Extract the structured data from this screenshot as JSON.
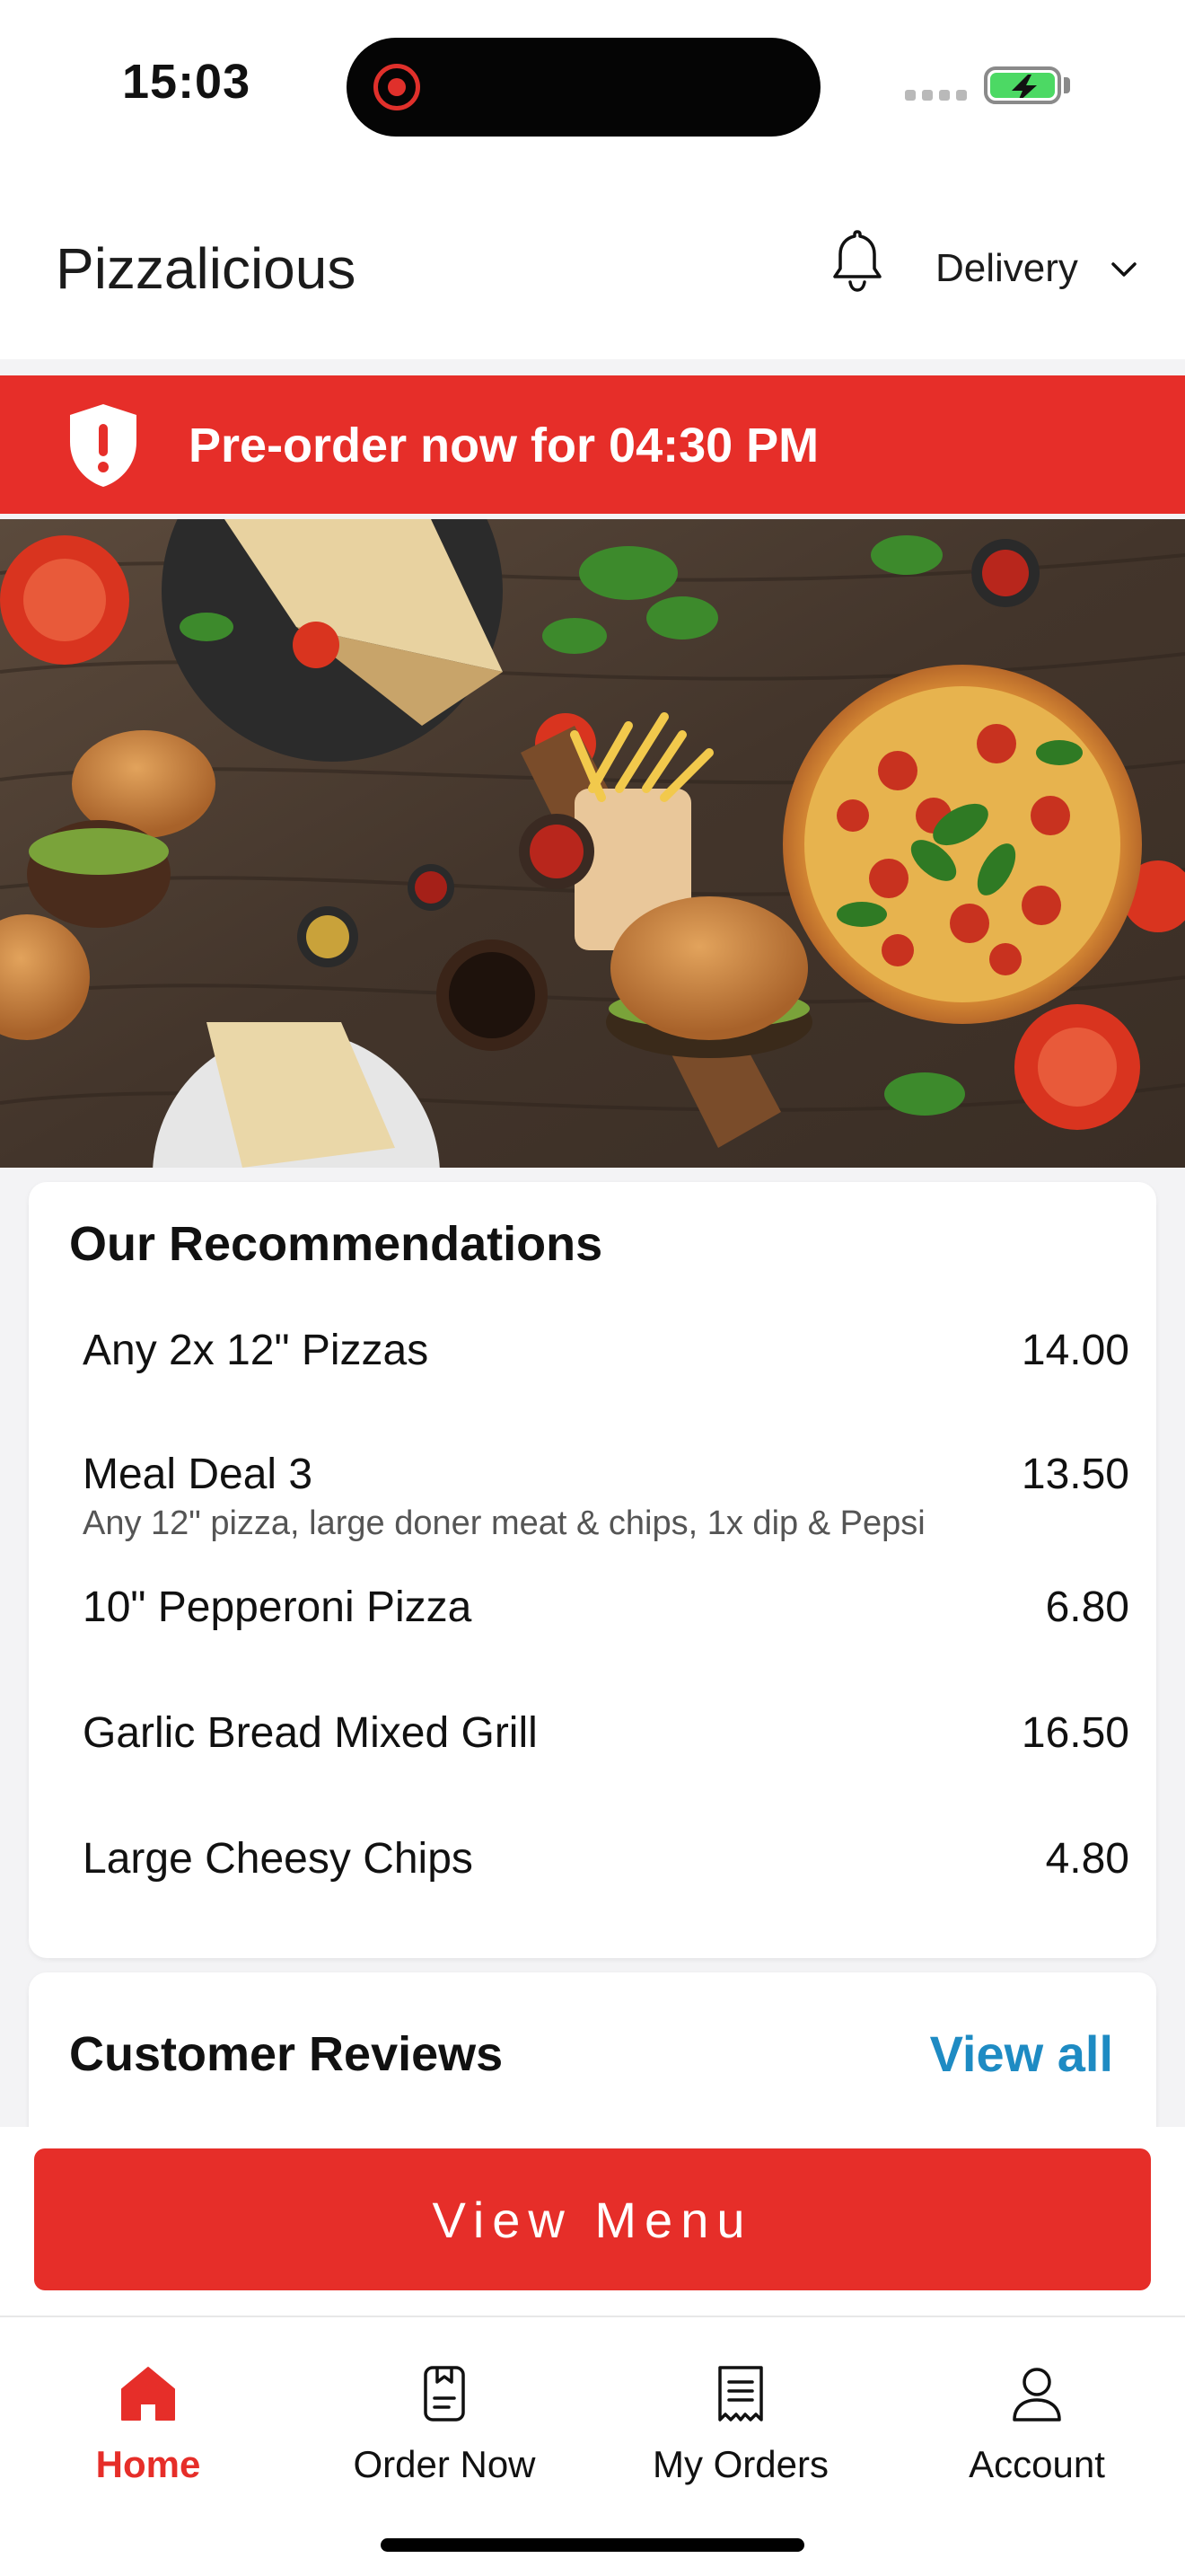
{
  "status_bar": {
    "time": "15:03"
  },
  "header": {
    "title": "Pizzalicious",
    "delivery_label": "Delivery"
  },
  "banner": {
    "text": "Pre-order now for 04:30 PM"
  },
  "recommendations": {
    "title": "Our Recommendations",
    "items": [
      {
        "name": "Any 2x 12\" Pizzas",
        "price": "14.00",
        "description": ""
      },
      {
        "name": "Meal Deal 3",
        "price": "13.50",
        "description": "Any 12\" pizza, large doner meat & chips, 1x dip & Pepsi"
      },
      {
        "name": "10\" Pepperoni Pizza",
        "price": "6.80",
        "description": ""
      },
      {
        "name": "Garlic Bread Mixed Grill",
        "price": "16.50",
        "description": ""
      },
      {
        "name": "Large Cheesy Chips",
        "price": "4.80",
        "description": ""
      }
    ]
  },
  "reviews": {
    "title": "Customer Reviews",
    "view_all_label": "View all"
  },
  "view_menu_label": "View Menu",
  "tabs": [
    {
      "label": "Home",
      "icon": "home-icon",
      "active": true
    },
    {
      "label": "Order Now",
      "icon": "order-icon",
      "active": false
    },
    {
      "label": "My Orders",
      "icon": "receipt-icon",
      "active": false
    },
    {
      "label": "Account",
      "icon": "user-icon",
      "active": false
    }
  ],
  "colors": {
    "accent": "#e62e29",
    "link": "#1e8bc3",
    "battery": "#4cd964"
  }
}
